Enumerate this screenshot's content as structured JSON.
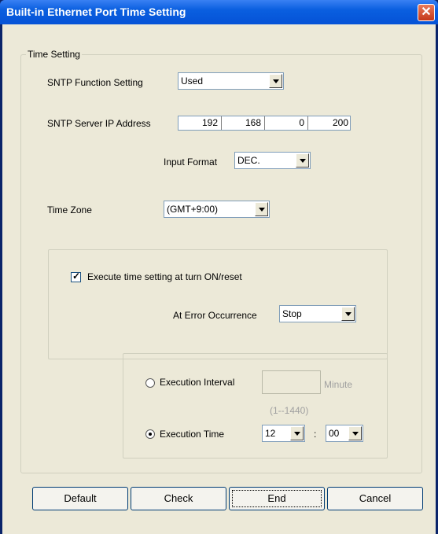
{
  "dialog": {
    "title": "Built-in Ethernet Port Time Setting",
    "close_glyph": "✕"
  },
  "time_setting": {
    "group_label": "Time Setting",
    "sntp_function": {
      "label": "SNTP Function Setting",
      "value": "Used"
    },
    "sntp_server": {
      "label": "SNTP Server IP Address",
      "octets": [
        "192",
        "168",
        "0",
        "200"
      ]
    },
    "input_format": {
      "label": "Input Format",
      "value": "DEC."
    },
    "time_zone": {
      "label": "Time Zone",
      "value": "(GMT+9:00)"
    }
  },
  "execute": {
    "checkbox_label": "Execute time setting at turn ON/reset",
    "checked": true,
    "error_occurrence": {
      "label": "At Error Occurrence",
      "value": "Stop"
    }
  },
  "schedule": {
    "interval": {
      "label": "Execution Interval",
      "value": "",
      "unit": "Minute",
      "range": "(1--1440)",
      "selected": false
    },
    "time": {
      "label": "Execution Time",
      "hour": "12",
      "separator": ":",
      "minute": "00",
      "selected": true
    }
  },
  "buttons": {
    "default": "Default",
    "check": "Check",
    "end": "End",
    "cancel": "Cancel"
  },
  "colors": {
    "title_bar": "#0552d6",
    "dialog_bg": "#ece9d8",
    "close_button": "#c4381a"
  }
}
